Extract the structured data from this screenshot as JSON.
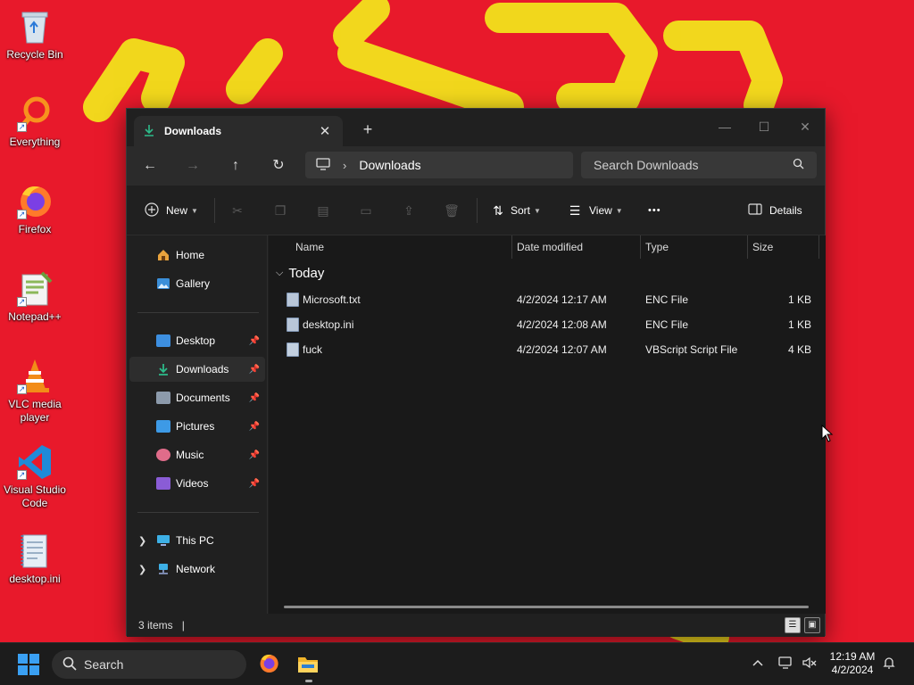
{
  "desktop": {
    "icons": [
      {
        "label": "Recycle Bin",
        "icon": "recycle-bin-icon",
        "shortcut": false
      },
      {
        "label": "Everything",
        "icon": "everything-search-icon",
        "shortcut": true
      },
      {
        "label": "Firefox",
        "icon": "firefox-icon",
        "shortcut": true
      },
      {
        "label": "Notepad++",
        "icon": "notepad-plus-plus-icon",
        "shortcut": true
      },
      {
        "label": "VLC media player",
        "icon": "vlc-cone-icon",
        "shortcut": true
      },
      {
        "label": "Visual Studio Code",
        "icon": "vscode-icon",
        "shortcut": true
      },
      {
        "label": "desktop.ini",
        "icon": "ini-file-icon",
        "shortcut": false
      }
    ]
  },
  "window": {
    "tab_title": "Downloads",
    "tab_close": "✕",
    "new_tab": "+",
    "controls": {
      "minimize": "—",
      "maximize": "☐",
      "close": "✕"
    },
    "nav": {
      "back": "←",
      "forward": "→",
      "up": "↑",
      "refresh": "↻"
    },
    "address": {
      "separator": "›",
      "crumb": "Downloads"
    },
    "search": {
      "placeholder": "Search Downloads"
    },
    "toolbar": {
      "new_label": "New",
      "sort_label": "Sort",
      "view_label": "View",
      "more_label": "•••",
      "details_label": "Details"
    },
    "sidebar": {
      "quick": [
        {
          "label": "Home",
          "icon": "home-icon",
          "color": "#e8a33d"
        },
        {
          "label": "Gallery",
          "icon": "gallery-icon",
          "color": "#3b8fd9"
        }
      ],
      "pinned": [
        {
          "label": "Desktop",
          "icon": "desktop-folder-icon",
          "color": "#3d8fe0",
          "pinned": true
        },
        {
          "label": "Downloads",
          "icon": "downloads-folder-icon",
          "color": "#2dbb8a",
          "pinned": true,
          "selected": true
        },
        {
          "label": "Documents",
          "icon": "documents-folder-icon",
          "color": "#8c9aab",
          "pinned": true
        },
        {
          "label": "Pictures",
          "icon": "pictures-folder-icon",
          "color": "#3d9ae6",
          "pinned": true
        },
        {
          "label": "Music",
          "icon": "music-folder-icon",
          "color": "#e06c8a",
          "pinned": true
        },
        {
          "label": "Videos",
          "icon": "videos-folder-icon",
          "color": "#8a5cd6",
          "pinned": true
        }
      ],
      "locations": [
        {
          "label": "This PC",
          "icon": "this-pc-icon",
          "color": "#3db0e6"
        },
        {
          "label": "Network",
          "icon": "network-icon",
          "color": "#3db0e6"
        }
      ]
    },
    "columns": {
      "name": "Name",
      "date": "Date modified",
      "type": "Type",
      "size": "Size"
    },
    "group_label": "Today",
    "files": [
      {
        "name": "Microsoft.txt",
        "date": "4/2/2024 12:17 AM",
        "type": "ENC File",
        "size": "1 KB",
        "icon": "text-file-icon"
      },
      {
        "name": "desktop.ini",
        "date": "4/2/2024 12:08 AM",
        "type": "ENC File",
        "size": "1 KB",
        "icon": "ini-file-icon"
      },
      {
        "name": "fuck",
        "date": "4/2/2024 12:07 AM",
        "type": "VBScript Script File",
        "size": "4 KB",
        "icon": "vbscript-file-icon"
      }
    ],
    "status": {
      "items": "3 items"
    }
  },
  "taskbar": {
    "search_placeholder": "Search",
    "time": "12:19 AM",
    "date": "4/2/2024",
    "tray_chevron": "^"
  },
  "colors": {
    "wallpaper": "#e8192b",
    "wallpaper_scribble": "#f2e21c",
    "window_bg": "#202020",
    "accent": "#3aa0f3"
  }
}
